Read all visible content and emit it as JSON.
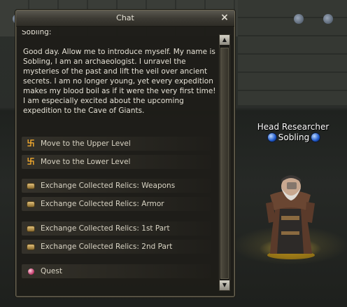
{
  "chat_window": {
    "title": "Chat",
    "close_glyph": "×",
    "truncated_first_line": "Sobling:",
    "dialogue": "Good day. Allow me to introduce myself. My name is Sobling, I am an archaeologist. I unravel the mysteries of the past and lift the veil over ancient secrets. I am no longer young, yet every expedition makes my blood boil as if it were the very first time! I am especially excited about the upcoming expedition to the Cave of Giants.",
    "options": [
      {
        "label": "Move to the Upper Level",
        "icon": "teleport-spiral-icon"
      },
      {
        "label": "Move to the Lower Level",
        "icon": "teleport-spiral-icon"
      },
      {
        "label": "Exchange Collected Relics: Weapons",
        "icon": "exchange-chest-icon"
      },
      {
        "label": "Exchange Collected Relics: Armor",
        "icon": "exchange-chest-icon"
      },
      {
        "label": "Exchange Collected Relics: 1st Part",
        "icon": "exchange-chest-icon"
      },
      {
        "label": "Exchange Collected Relics: 2nd Part",
        "icon": "exchange-chest-icon"
      },
      {
        "label": "Quest",
        "icon": "quest-icon"
      }
    ],
    "scroll_up_glyph": "▲",
    "scroll_down_glyph": "▼"
  },
  "npc": {
    "title": "Head Researcher",
    "name": "Sobling"
  },
  "colors": {
    "teleport_icon": "#ffb22e",
    "window_border": "#6c6754",
    "npc_orb": "#1e57c8"
  }
}
